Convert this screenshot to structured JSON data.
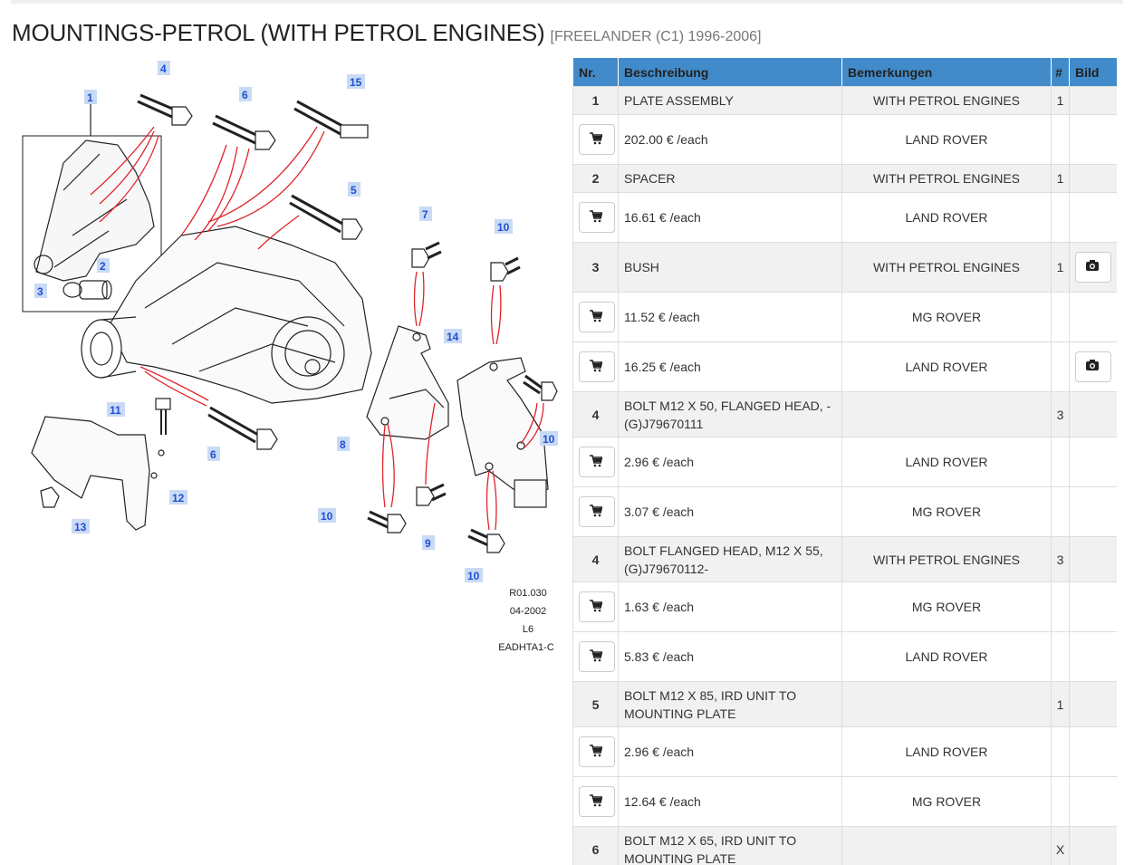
{
  "title": "MOUNTINGS-PETROL (WITH PETROL ENGINES)",
  "subtitle": "[FREELANDER (C1) 1996-2006]",
  "diagram": {
    "callouts": [
      "1",
      "2",
      "3",
      "4",
      "5",
      "6",
      "6",
      "7",
      "8",
      "9",
      "10",
      "10",
      "10",
      "10",
      "11",
      "12",
      "13",
      "14",
      "15"
    ],
    "footer": [
      "R01.030",
      "04-2002",
      "L6",
      "EADHTA1-C"
    ]
  },
  "table": {
    "headers": [
      "Nr.",
      "Beschreibung",
      "Bemerkungen",
      "#",
      "Bild"
    ],
    "rows": [
      {
        "kind": "part",
        "nr": "1",
        "desc": "PLATE ASSEMBLY",
        "remark": "WITH PETROL ENGINES",
        "qty": "1",
        "photo": false
      },
      {
        "kind": "offer",
        "price": "202.00 € /each",
        "brand": "LAND ROVER",
        "photo": false
      },
      {
        "kind": "part",
        "nr": "2",
        "desc": "SPACER",
        "remark": "WITH PETROL ENGINES",
        "qty": "1",
        "photo": false
      },
      {
        "kind": "offer",
        "price": "16.61 € /each",
        "brand": "LAND ROVER",
        "photo": false
      },
      {
        "kind": "part",
        "nr": "3",
        "desc": "BUSH",
        "remark": "WITH PETROL ENGINES",
        "qty": "1",
        "photo": true
      },
      {
        "kind": "offer",
        "price": "11.52 € /each",
        "brand": "MG ROVER",
        "photo": false
      },
      {
        "kind": "offer",
        "price": "16.25 € /each",
        "brand": "LAND ROVER",
        "photo": true
      },
      {
        "kind": "part",
        "nr": "4",
        "desc": "BOLT M12 X 50, FLANGED HEAD, -(G)J79670111",
        "remark": "",
        "qty": "3",
        "photo": false
      },
      {
        "kind": "offer",
        "price": "2.96 € /each",
        "brand": "LAND ROVER",
        "photo": false
      },
      {
        "kind": "offer",
        "price": "3.07 € /each",
        "brand": "MG ROVER",
        "photo": false
      },
      {
        "kind": "part",
        "nr": "4",
        "desc": "BOLT FLANGED HEAD, M12 X 55, (G)J79670112-",
        "remark": "WITH PETROL ENGINES",
        "qty": "3",
        "photo": false
      },
      {
        "kind": "offer",
        "price": "1.63 € /each",
        "brand": "MG ROVER",
        "photo": false
      },
      {
        "kind": "offer",
        "price": "5.83 € /each",
        "brand": "LAND ROVER",
        "photo": false
      },
      {
        "kind": "part",
        "nr": "5",
        "desc": "BOLT M12 X 85, IRD UNIT TO MOUNTING PLATE",
        "remark": "",
        "qty": "1",
        "photo": false
      },
      {
        "kind": "offer",
        "price": "2.96 € /each",
        "brand": "LAND ROVER",
        "photo": false
      },
      {
        "kind": "offer",
        "price": "12.64 € /each",
        "brand": "MG ROVER",
        "photo": false
      },
      {
        "kind": "part",
        "nr": "6",
        "desc": "BOLT M12 X 65, IRD UNIT TO MOUNTING PLATE",
        "remark": "",
        "qty": "X",
        "photo": false
      }
    ]
  },
  "icons": {
    "cart": "cart-icon",
    "photo": "camera-icon"
  },
  "colors": {
    "header_bg": "#428bca",
    "callout_text": "#1f4fd1",
    "callout_bg": "#c9daf5",
    "leader_line": "#e0242a",
    "part_row_bg": "#f1f1f1"
  }
}
